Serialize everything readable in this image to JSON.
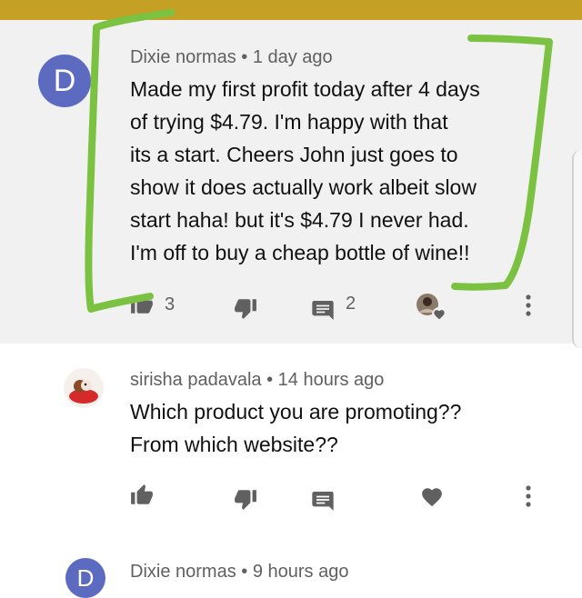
{
  "comments": [
    {
      "avatar_letter": "D",
      "author": "Dixie normas",
      "time": "1 day ago",
      "lines": [
        "Made my first profit today after 4 days",
        "of trying $4.79. I'm happy with that",
        "its a start.  Cheers John just goes to",
        "show it does actually work albeit slow",
        "start haha! but it's $4.79 I never had.",
        "I'm off to buy a cheap bottle of wine!!"
      ],
      "likes": "3",
      "replies": "2"
    },
    {
      "author": "sirisha padavala",
      "time": "14 hours ago",
      "lines": [
        "Which product you are promoting??",
        "From which website??"
      ]
    },
    {
      "avatar_letter": "D",
      "author": "Dixie normas",
      "time": "9 hours ago"
    }
  ],
  "colors": {
    "top_bar": "#c4a124",
    "highlight_bg": "#f1f1f1",
    "avatar_d": "#5c6bc0",
    "annotation": "#7cc242",
    "icon": "#606060"
  },
  "icons": [
    "thumb-up-icon",
    "thumb-down-icon",
    "comment-icon",
    "heart-icon",
    "more-vert-icon"
  ]
}
